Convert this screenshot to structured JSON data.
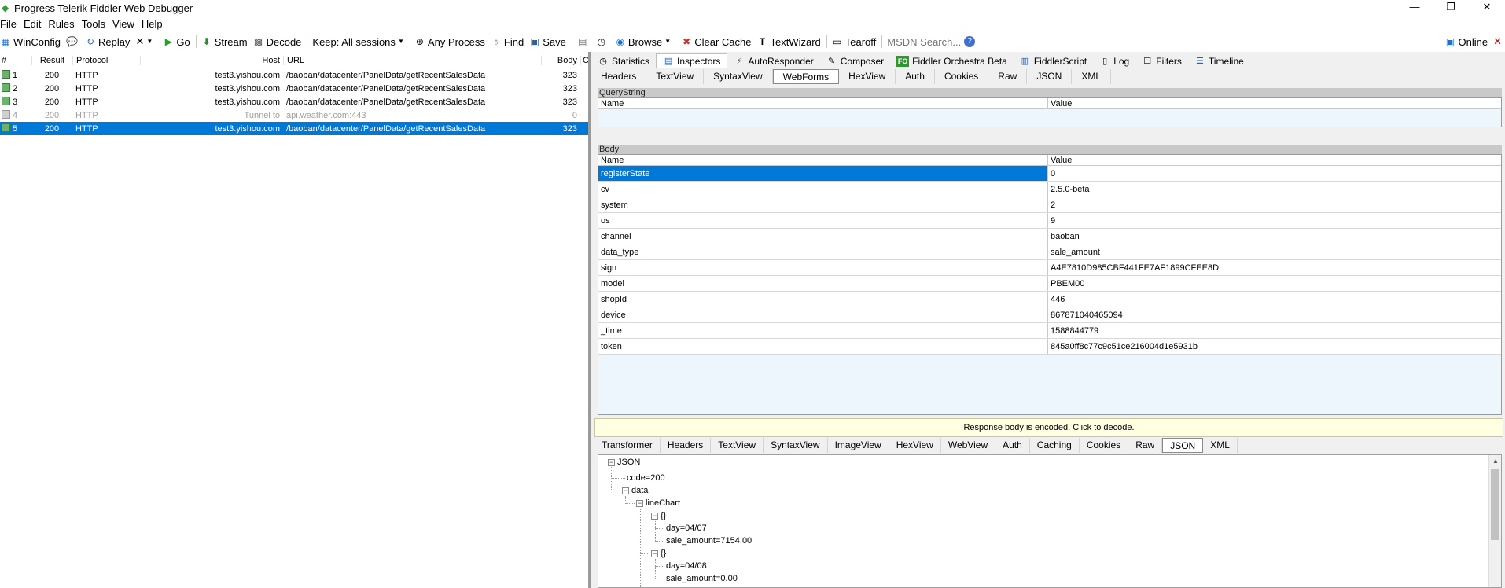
{
  "window": {
    "title": "Progress Telerik Fiddler Web Debugger",
    "controls": {
      "minimize": "—",
      "restore": "❐",
      "close": "✕"
    }
  },
  "menu": [
    "File",
    "Edit",
    "Rules",
    "Tools",
    "View",
    "Help"
  ],
  "toolbar": {
    "winconfig": "WinConfig",
    "replay": "Replay",
    "remove": "✕",
    "go": "Go",
    "stream": "Stream",
    "decode": "Decode",
    "keep": "Keep: All sessions",
    "any_process": "Any Process",
    "find": "Find",
    "save": "Save",
    "browse": "Browse",
    "clear_cache": "Clear Cache",
    "textwizard": "TextWizard",
    "tearoff": "Tearoff",
    "msdn_search": "MSDN Search...",
    "online": "Online"
  },
  "sessions": {
    "columns": {
      "num": "#",
      "result": "Result",
      "protocol": "Protocol",
      "host": "Host",
      "url": "URL",
      "body": "Body",
      "caching": "Ca"
    },
    "rows": [
      {
        "num": "1",
        "result": "200",
        "protocol": "HTTP",
        "host": "test3.yishou.com",
        "url": "/baoban/datacenter/PanelData/getRecentSalesData",
        "body": "323"
      },
      {
        "num": "2",
        "result": "200",
        "protocol": "HTTP",
        "host": "test3.yishou.com",
        "url": "/baoban/datacenter/PanelData/getRecentSalesData",
        "body": "323"
      },
      {
        "num": "3",
        "result": "200",
        "protocol": "HTTP",
        "host": "test3.yishou.com",
        "url": "/baoban/datacenter/PanelData/getRecentSalesData",
        "body": "323"
      },
      {
        "num": "4",
        "result": "200",
        "protocol": "HTTP",
        "host": "Tunnel to",
        "url": "api.weather.com:443",
        "body": "0"
      },
      {
        "num": "5",
        "result": "200",
        "protocol": "HTTP",
        "host": "test3.yishou.com",
        "url": "/baoban/datacenter/PanelData/getRecentSalesData",
        "body": "323"
      }
    ]
  },
  "main_tabs": [
    "Statistics",
    "Inspectors",
    "AutoResponder",
    "Composer",
    "Fiddler Orchestra Beta",
    "FiddlerScript",
    "Log",
    "Filters",
    "Timeline"
  ],
  "main_tab_icons": {
    "fo": "FO"
  },
  "request_tabs": [
    "Headers",
    "TextView",
    "SyntaxView",
    "WebForms",
    "HexView",
    "Auth",
    "Cookies",
    "Raw",
    "JSON",
    "XML"
  ],
  "querystring": {
    "title": "QueryString",
    "name_col": "Name",
    "value_col": "Value"
  },
  "body": {
    "title": "Body",
    "name_col": "Name",
    "value_col": "Value",
    "rows": [
      {
        "name": "registerState",
        "value": "0"
      },
      {
        "name": "cv",
        "value": "2.5.0-beta"
      },
      {
        "name": "system",
        "value": "2"
      },
      {
        "name": "os",
        "value": "9"
      },
      {
        "name": "channel",
        "value": "baoban"
      },
      {
        "name": "data_type",
        "value": "sale_amount"
      },
      {
        "name": "sign",
        "value": "A4E7810D985CBF441FE7AF1899CFEE8D"
      },
      {
        "name": "model",
        "value": "PBEM00"
      },
      {
        "name": "shopId",
        "value": "446"
      },
      {
        "name": "device",
        "value": "867871040465094"
      },
      {
        "name": "_time",
        "value": "1588844779"
      },
      {
        "name": "token",
        "value": "845a0ff8c77c9c51ce216004d1e5931b"
      }
    ]
  },
  "notice": "Response body is encoded. Click to decode.",
  "response_tabs": [
    "Transformer",
    "Headers",
    "TextView",
    "SyntaxView",
    "ImageView",
    "HexView",
    "WebView",
    "Auth",
    "Caching",
    "Cookies",
    "Raw",
    "JSON",
    "XML"
  ],
  "tree": {
    "root": "JSON",
    "code": "code=200",
    "data": "data",
    "linechart": "lineChart",
    "obj": "{}",
    "day1": "day=04/07",
    "amt1": "sale_amount=7154.00",
    "day2": "day=04/08",
    "amt2": "sale_amount=0.00",
    "toggle": "−"
  }
}
